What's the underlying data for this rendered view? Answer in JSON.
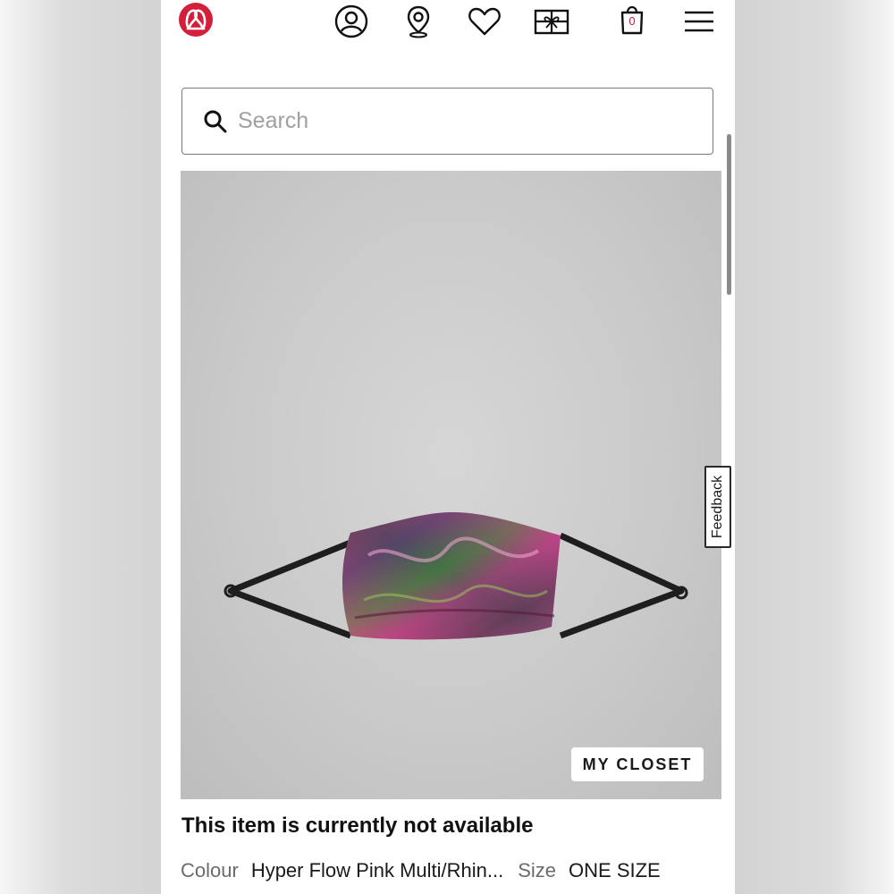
{
  "header": {
    "logo": "lululemon-logo",
    "icons": [
      "account-icon",
      "store-locator-icon",
      "wishlist-icon",
      "gift-card-icon",
      "bag-icon",
      "menu-icon"
    ],
    "bag_count": "0"
  },
  "search": {
    "placeholder": "Search",
    "value": ""
  },
  "product": {
    "image": "face-mask-product-image",
    "my_closet_label": "MY CLOSET",
    "availability": "This item is currently not available",
    "colour_label": "Colour",
    "colour_value": "Hyper Flow Pink Multi/Rhin...",
    "size_label": "Size",
    "size_value": "ONE SIZE"
  },
  "feedback_tab": {
    "label": "Feedback"
  },
  "colors": {
    "brand": "#d31f3a",
    "text": "#111111",
    "muted": "#6b6b6b"
  }
}
